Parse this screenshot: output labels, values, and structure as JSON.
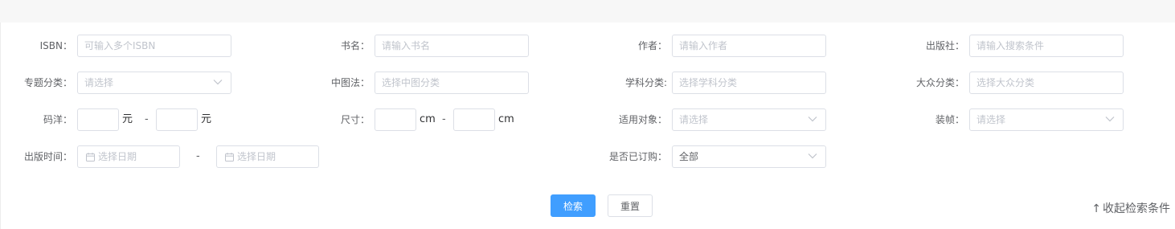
{
  "filters": {
    "isbn": {
      "label": "ISBN：",
      "placeholder": "可输入多个ISBN"
    },
    "title": {
      "label": "书名：",
      "placeholder": "请输入书名"
    },
    "author": {
      "label": "作者：",
      "placeholder": "请输入作者"
    },
    "publisher": {
      "label": "出版社：",
      "placeholder": "请输入搜索条件"
    },
    "topic": {
      "label": "专题分类：",
      "placeholder": "请选择"
    },
    "clc": {
      "label": "中图法：",
      "placeholder": "选择中图分类"
    },
    "subject": {
      "label": "学科分类:",
      "placeholder": "选择学科分类"
    },
    "popular": {
      "label": "大众分类：",
      "placeholder": "选择大众分类"
    },
    "price": {
      "label": "码洋：",
      "unit": "元",
      "separator": "-"
    },
    "size": {
      "label": "尺寸：",
      "unit": "cm",
      "separator": "-"
    },
    "audience": {
      "label": "适用对象：",
      "placeholder": "请选择"
    },
    "binding": {
      "label": "装帧：",
      "placeholder": "请选择"
    },
    "pubdate": {
      "label": "出版时间：",
      "start_placeholder": "选择日期",
      "end_placeholder": "选择日期",
      "separator": "-"
    },
    "ordered": {
      "label": "是否已订购：",
      "value": "全部"
    }
  },
  "actions": {
    "search_label": "检索",
    "reset_label": "重置"
  },
  "collapse": {
    "arrow": "↑",
    "label": "收起检索条件"
  },
  "colors": {
    "primary": "#409eff",
    "border": "#dcdfe6",
    "placeholder": "#c0c4cc",
    "topbar": "#f7f7f7"
  }
}
